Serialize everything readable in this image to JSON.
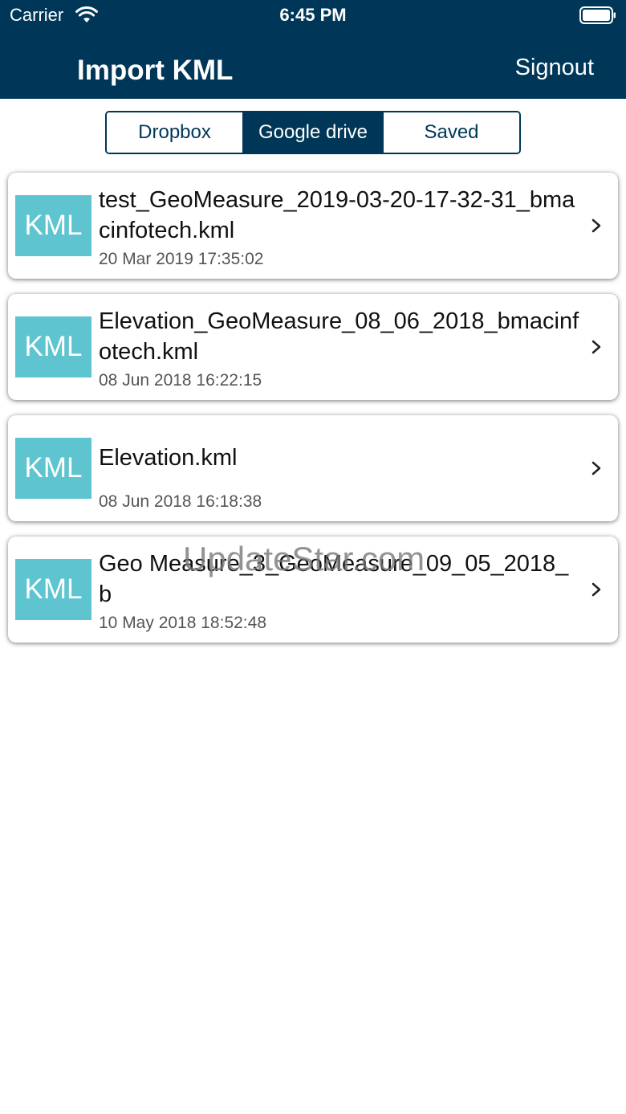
{
  "status_bar": {
    "carrier": "Carrier",
    "time": "6:45 PM"
  },
  "header": {
    "title": "Import KML",
    "signout_label": "Signout",
    "background_color": "#003758"
  },
  "tabs": [
    {
      "label": "Dropbox",
      "selected": false
    },
    {
      "label": "Google drive",
      "selected": true
    },
    {
      "label": "Saved",
      "selected": false
    }
  ],
  "files": [
    {
      "badge": "KML",
      "name": "test_GeoMeasure_2019-03-20-17-32-31_bmacinfotech.kml",
      "date": "20 Mar 2019 17:35:02"
    },
    {
      "badge": "KML",
      "name": "Elevation_GeoMeasure_08_06_2018_bmacinfotech.kml",
      "date": "08 Jun 2018 16:22:15"
    },
    {
      "badge": "KML",
      "name": "Elevation.kml",
      "date": "08 Jun 2018 16:18:38"
    },
    {
      "badge": "KML",
      "name": "Geo Measure_3_GeoMeasure_09_05_2018_b",
      "date": "10 May 2018 18:52:48"
    }
  ],
  "watermark": "UpdateStar.com",
  "icons": {
    "wifi": "wifi-icon",
    "battery": "battery-icon",
    "row_chevron": "chevron-right-icon"
  },
  "colors": {
    "badge": "#5ec4cf",
    "accent": "#003758"
  }
}
